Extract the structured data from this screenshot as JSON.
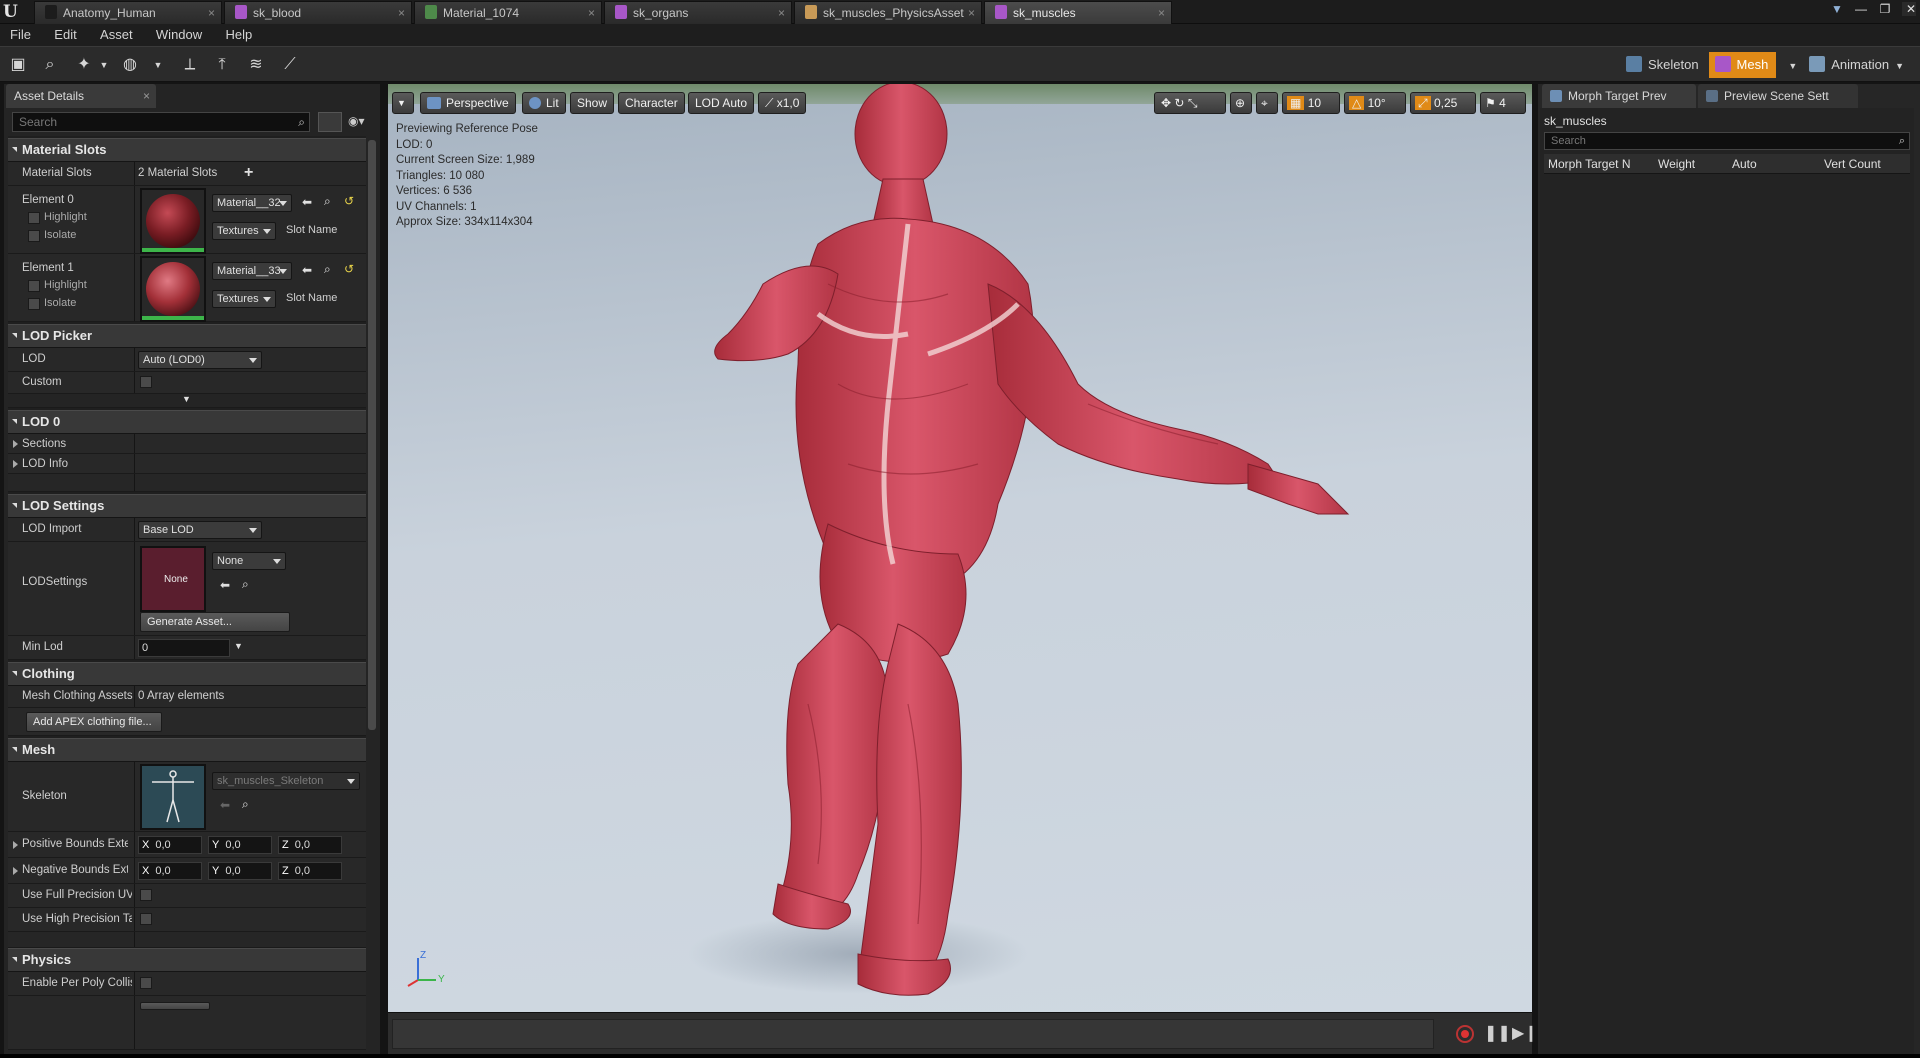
{
  "window": {
    "tabs": [
      {
        "label": "Anatomy_Human",
        "icon_color": "#1c1c1c"
      },
      {
        "label": "sk_blood",
        "icon_color": "#a857c8"
      },
      {
        "label": "Material_1074",
        "icon_color": "#4e8a4a"
      },
      {
        "label": "sk_organs",
        "icon_color": "#a857c8"
      },
      {
        "label": "sk_muscles_PhysicsAsset",
        "icon_color": "#c89a57"
      },
      {
        "label": "sk_muscles",
        "icon_color": "#a857c8"
      }
    ],
    "close_glyph": "×",
    "controls": {
      "minimize": "—",
      "maximize": "❐",
      "close": "✕"
    }
  },
  "menu": [
    "File",
    "Edit",
    "Asset",
    "Window",
    "Help"
  ],
  "modes": [
    {
      "label": "Skeleton",
      "active": false
    },
    {
      "label": "Mesh",
      "active": true
    },
    {
      "label": "Animation",
      "active": false
    }
  ],
  "left_panel": {
    "tab_label": "Asset Details",
    "search_placeholder": "Search",
    "material_slots": {
      "title": "Material Slots",
      "label": "Material Slots",
      "count_text": "2 Material Slots",
      "add_glyph": "+",
      "elements": [
        {
          "label": "Element 0",
          "highlight": "Highlight",
          "isolate": "Isolate",
          "material": "Material__32",
          "textures": "Textures",
          "slot_name": "Slot Name"
        },
        {
          "label": "Element 1",
          "highlight": "Highlight",
          "isolate": "Isolate",
          "material": "Material__33",
          "textures": "Textures",
          "slot_name": "Slot Name"
        }
      ]
    },
    "lod_picker": {
      "title": "LOD Picker",
      "lod_label": "LOD",
      "lod_value": "Auto (LOD0)",
      "custom_label": "Custom"
    },
    "lod0": {
      "title": "LOD 0",
      "sections": "Sections",
      "lod_info": "LOD Info"
    },
    "lod_settings": {
      "title": "LOD Settings",
      "lod_import_label": "LOD Import",
      "lod_import_value": "Base LOD",
      "lodsettings_label": "LODSettings",
      "thumb_text": "None",
      "lodsettings_value": "None",
      "generate_button": "Generate Asset...",
      "min_lod_label": "Min Lod",
      "min_lod_value": "0"
    },
    "clothing": {
      "title": "Clothing",
      "mesh_clothing_label": "Mesh Clothing Assets",
      "mesh_clothing_value": "0 Array elements",
      "add_apex_button": "Add APEX clothing file..."
    },
    "mesh": {
      "title": "Mesh",
      "skeleton_label": "Skeleton",
      "skeleton_value": "sk_muscles_Skeleton",
      "positive_bounds_label": "Positive Bounds Extension",
      "negative_bounds_label": "Negative Bounds Extension",
      "axes": [
        "X",
        "Y",
        "Z"
      ],
      "bounds_value": "0,0",
      "full_precision_label": "Use Full Precision UVs",
      "high_precision_label": "Use High Precision Tangent Basis"
    },
    "physics": {
      "title": "Physics",
      "enable_per_poly_label": "Enable Per Poly Collision"
    }
  },
  "viewport": {
    "toolbar": {
      "perspective": "Perspective",
      "lit": "Lit",
      "show": "Show",
      "character": "Character",
      "lod": "LOD Auto",
      "speed": "x1,0",
      "grid_value": "10",
      "angle_value": "10°",
      "scale_value": "0,25",
      "camera_speed": "4"
    },
    "stats": [
      "Previewing Reference Pose",
      "LOD: 0",
      "Current Screen Size: 1,989",
      "Triangles: 10 080",
      "Vertices: 6 536",
      "UV Channels: 1",
      "Approx Size: 334x114x304"
    ],
    "axes": {
      "z": "Z",
      "y": "Y"
    }
  },
  "right_panel": {
    "tabs": [
      "Morph Target Prev",
      "Preview Scene Sett"
    ],
    "asset_name": "sk_muscles",
    "search_placeholder": "Search",
    "columns": [
      "Morph Target N",
      "Weight",
      "Auto",
      "Vert Count"
    ]
  },
  "colors": {
    "accent": "#e08a17",
    "muscle": "#c8434f"
  }
}
